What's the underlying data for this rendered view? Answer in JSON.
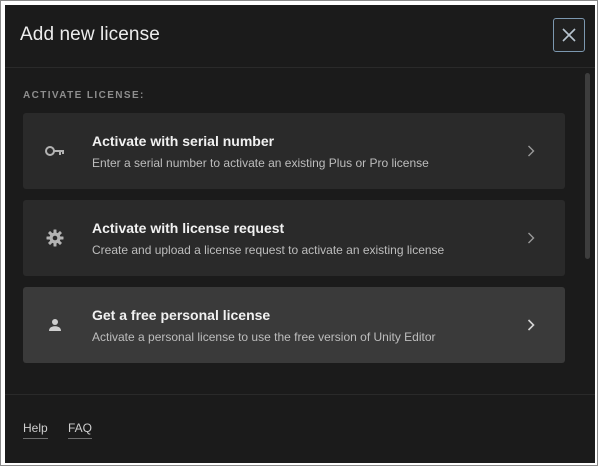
{
  "dialog": {
    "title": "Add new license",
    "close_icon": "close-icon"
  },
  "section_label": "ACTIVATE LICENSE:",
  "options": [
    {
      "title": "Activate with serial number",
      "description": "Enter a serial number to activate an existing Plus or Pro license",
      "icon": "key-icon",
      "selected": false
    },
    {
      "title": "Activate with license request",
      "description": "Create and upload a license request to activate an existing license",
      "icon": "gear-icon",
      "selected": false
    },
    {
      "title": "Get a free personal license",
      "description": "Activate a personal license to use the free version of Unity Editor",
      "icon": "person-icon",
      "selected": true
    }
  ],
  "footer": {
    "links": [
      "Help",
      "FAQ"
    ]
  },
  "colors": {
    "background": "#1b1b1b",
    "card": "#2a2a2a",
    "card_selected": "#3a3a3a",
    "close_border": "#7c98b0"
  }
}
